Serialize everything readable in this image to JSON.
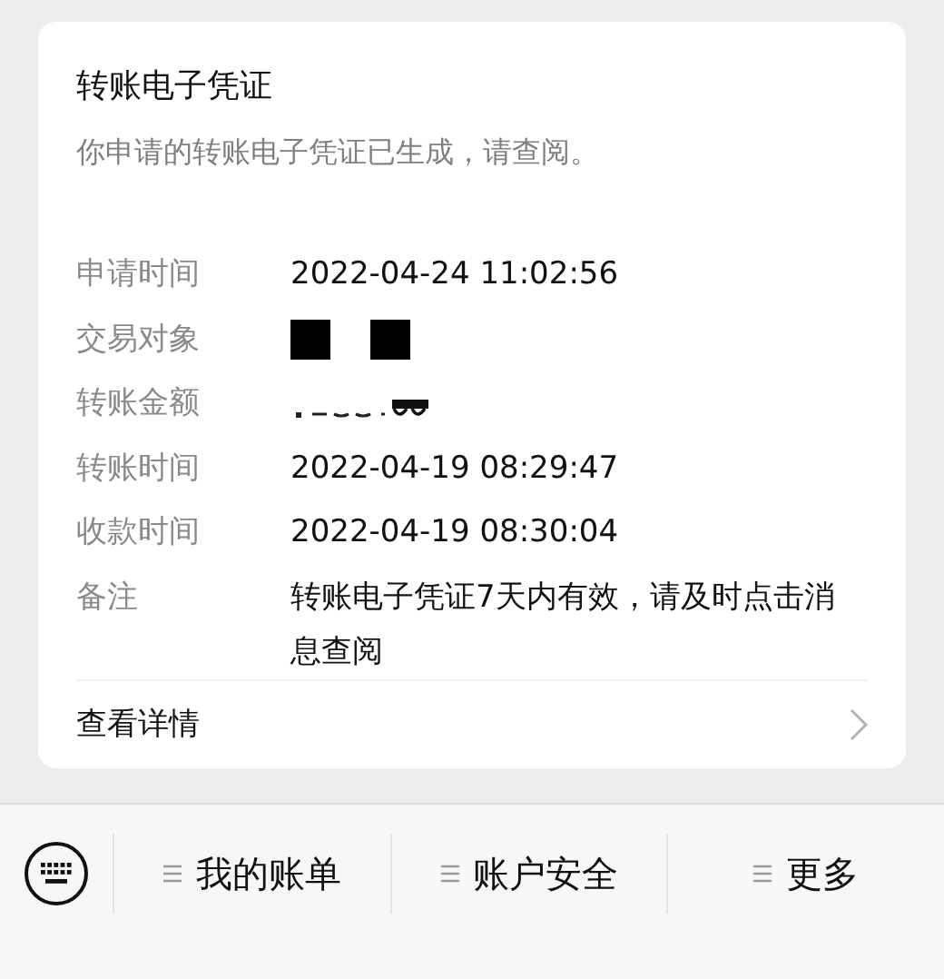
{
  "card": {
    "title": "转账电子凭证",
    "subtitle": "你申请的转账电子凭证已生成，请查阅。",
    "rows": [
      {
        "label": "申请时间",
        "kind": "text",
        "value": "2022-04-24 11:02:56"
      },
      {
        "label": "交易对象",
        "kind": "redacted"
      },
      {
        "label": "转账金额",
        "kind": "obscured"
      },
      {
        "label": "转账时间",
        "kind": "text",
        "value": "2022-04-19 08:29:47"
      },
      {
        "label": "收款时间",
        "kind": "text",
        "value": "2022-04-19 08:30:04"
      },
      {
        "label": "备注",
        "kind": "text",
        "value": "转账电子凭证7天内有效，请及时点击消息查阅"
      }
    ],
    "link": "查看详情"
  },
  "menu": [
    "我的账单",
    "账户安全",
    "更多"
  ]
}
